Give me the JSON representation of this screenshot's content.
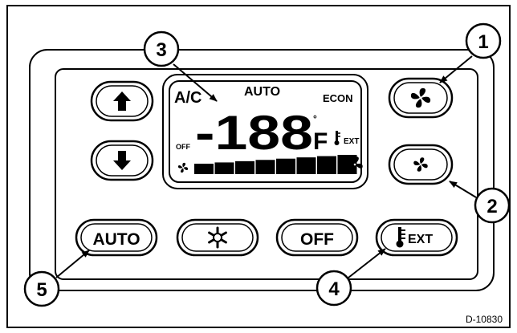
{
  "lcd": {
    "ac_label": "A/C",
    "auto_label": "AUTO",
    "econ_label": "ECON",
    "temperature": "-188",
    "temp_unit": "F",
    "temp_degree": "°",
    "off_label": "OFF",
    "ext_label": "EXT",
    "fan_bar_segments": 8
  },
  "buttons": {
    "auto_label": "AUTO",
    "off_label": "OFF",
    "ext_label": "EXT"
  },
  "callouts": [
    "1",
    "2",
    "3",
    "4",
    "5"
  ],
  "figure_id": "D-10830",
  "icons": {
    "up": "arrow-up-icon",
    "down": "arrow-down-icon",
    "fan_high": "fan-high-icon",
    "fan_low": "fan-low-icon",
    "snowflake": "snowflake-icon",
    "thermometer": "thermometer-icon"
  }
}
